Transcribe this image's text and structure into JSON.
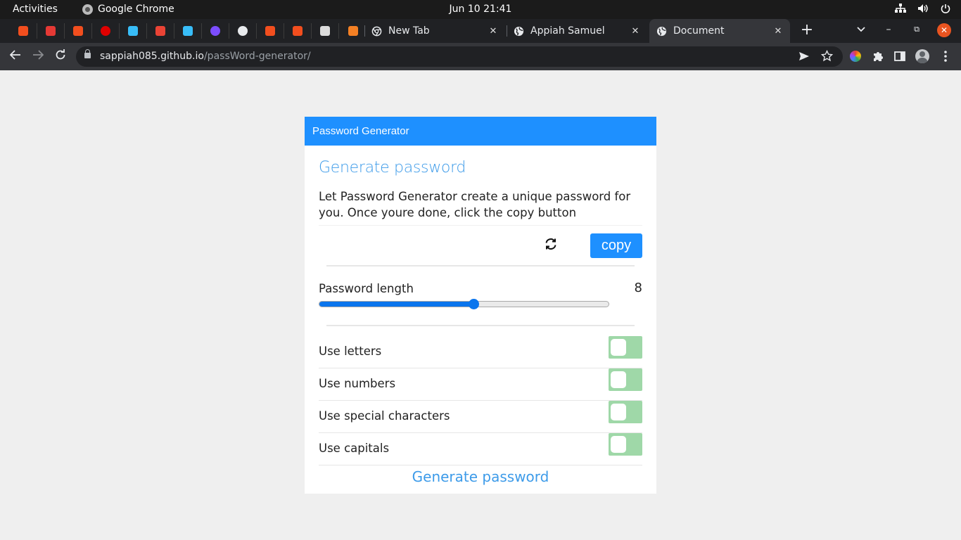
{
  "system_bar": {
    "activities": "Activities",
    "app_name": "Google Chrome",
    "datetime": "Jun 10  21:41"
  },
  "browser": {
    "pinned_tabs": [
      {
        "icon": "figma-icon",
        "color": "#f24e1e"
      },
      {
        "icon": "dashed-logo-icon",
        "color": "#e53935"
      },
      {
        "icon": "figma-icon",
        "color": "#f24e1e"
      },
      {
        "icon": "record-icon",
        "color": "#e00000"
      },
      {
        "icon": "tailwind-icon",
        "color": "#38bdf8"
      },
      {
        "icon": "gmail-icon",
        "color": "#ea4335"
      },
      {
        "icon": "tailwind-icon",
        "color": "#38bdf8"
      },
      {
        "icon": "s-badge-icon",
        "color": "#7c4dff"
      },
      {
        "icon": "globe-icon",
        "color": "#e8eaed"
      },
      {
        "icon": "figma-icon",
        "color": "#f24e1e"
      },
      {
        "icon": "figma-icon",
        "color": "#f24e1e"
      },
      {
        "icon": "hand-icon",
        "color": "#dcdcdc"
      },
      {
        "icon": "stackoverflow-icon",
        "color": "#f48024"
      }
    ],
    "tabs": [
      {
        "title": "New Tab",
        "icon": "chrome-icon",
        "active": false
      },
      {
        "title": "Appiah Samuel",
        "icon": "globe-icon",
        "active": false
      },
      {
        "title": "Document",
        "icon": "globe-icon",
        "active": true
      }
    ],
    "url_host": "sappiah085.github.io",
    "url_path": "/passWord-generator/"
  },
  "app": {
    "header": "Password Generator",
    "title": "Generate password",
    "description": "Let Password Generator create a unique password for you. Once youre done, click the copy button",
    "password_value": "",
    "copy_label": "copy",
    "length_label": "Password length",
    "length_value": "8",
    "length_fill": 0.533,
    "options": [
      {
        "label": "Use letters",
        "enabled": false
      },
      {
        "label": "Use numbers",
        "enabled": false
      },
      {
        "label": "Use special characters",
        "enabled": false
      },
      {
        "label": "Use capitals",
        "enabled": false
      }
    ],
    "generate_label": "Generate password"
  },
  "colors": {
    "accent": "#1e90ff",
    "title_blue": "#3d9be9",
    "slider_blue": "#0a75ed",
    "toggle_off": "#9fd8a8"
  }
}
